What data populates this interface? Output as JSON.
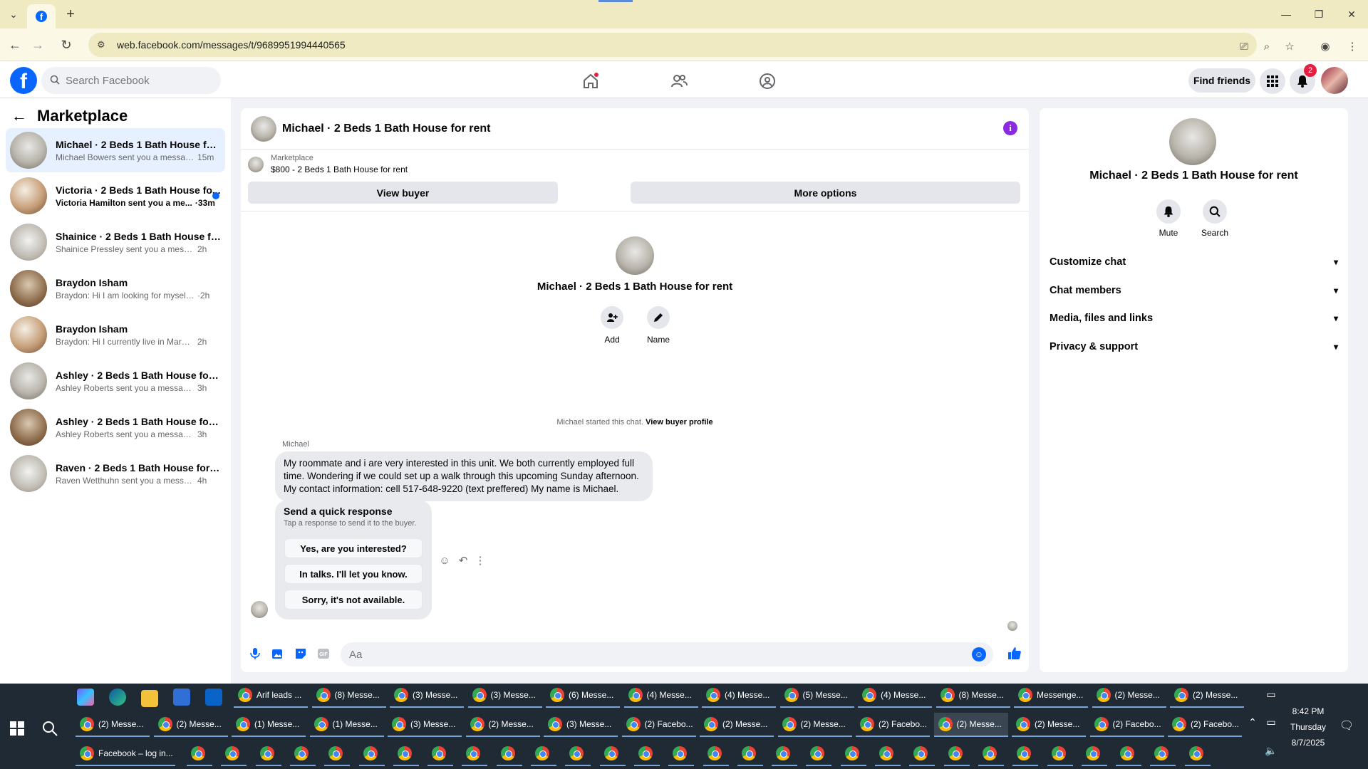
{
  "browser": {
    "url": "web.facebook.com/messages/t/9689951994440565"
  },
  "fb": {
    "search_placeholder": "Search Facebook",
    "find_friends": "Find friends",
    "notif_count": "2"
  },
  "sidebar": {
    "title": "Marketplace",
    "conversations": [
      {
        "name": "Michael · 2 Beds 1 Bath House for ...",
        "snippet": "Michael Bowers sent you a message...",
        "time": "15m",
        "active": true,
        "unread": false
      },
      {
        "name": "Victoria · 2 Beds 1 Bath House fo...",
        "snippet": "Victoria Hamilton sent you a me...",
        "time": "·33m",
        "active": false,
        "unread": true
      },
      {
        "name": "Shainice · 2 Beds 1 Bath House for ...",
        "snippet": "Shainice Pressley sent you a message ...",
        "time": "2h",
        "active": false,
        "unread": false
      },
      {
        "name": "Braydon Isham",
        "snippet": "Braydon: Hi I am looking for myself o...",
        "time": "·2h",
        "active": false,
        "unread": false
      },
      {
        "name": "Braydon Isham",
        "snippet": "Braydon: Hi I currently live in Marquet...",
        "time": "2h",
        "active": false,
        "unread": false
      },
      {
        "name": "Ashley · 2 Beds 1 Bath House for re...",
        "snippet": "Ashley Roberts sent you a message a...",
        "time": "3h",
        "active": false,
        "unread": false
      },
      {
        "name": "Ashley · 2 Beds 1 Bath House for re...",
        "snippet": "Ashley Roberts sent you a message a...",
        "time": "3h",
        "active": false,
        "unread": false
      },
      {
        "name": "Raven · 2 Beds 1 Bath House for rent",
        "snippet": "Raven Wetthuhn sent you a message ...",
        "time": "4h",
        "active": false,
        "unread": false
      }
    ]
  },
  "chat": {
    "title": "Michael · 2 Beds 1 Bath House for rent",
    "listing_source": "Marketplace",
    "listing_title": "$800 - 2 Beds 1 Bath House for rent",
    "view_buyer": "View buyer",
    "more_options": "More options",
    "intro_name": "Michael · 2 Beds 1 Bath House for rent",
    "add_label": "Add",
    "name_label": "Name",
    "started_text": "Michael started this chat.",
    "started_link": "View buyer profile",
    "sender": "Michael",
    "message": "My roommate and i are very interested in this unit. We both currently employed full time. Wondering if we could set up a walk through this upcoming Sunday afternoon. My contact information: cell 517-648-9220 (text preffered) My name is Michael.",
    "quick_title": "Send a quick response",
    "quick_sub": "Tap a response to send it to the buyer.",
    "quick_replies": [
      "Yes, are you interested?",
      "In talks. I'll let you know.",
      "Sorry, it's not available."
    ],
    "input_placeholder": "Aa"
  },
  "info": {
    "name": "Michael · 2 Beds 1 Bath House for rent",
    "mute": "Mute",
    "search": "Search",
    "rows": [
      "Customize chat",
      "Chat members",
      "Media, files and links",
      "Privacy & support"
    ]
  },
  "taskbar": {
    "row1": [
      "Arif leads ...",
      "(8) Messe...",
      "(3) Messe...",
      "(3) Messe...",
      "(6) Messe...",
      "(4) Messe...",
      "(4) Messe...",
      "(5) Messe...",
      "(4) Messe...",
      "(8) Messe...",
      "Messenge...",
      "(2) Messe...",
      "(2) Messe..."
    ],
    "row2": [
      "(2) Messe...",
      "(2) Messe...",
      "(1) Messe...",
      "(1) Messe...",
      "(3) Messe...",
      "(2) Messe...",
      "(3) Messe...",
      "(2) Facebo...",
      "(2) Messe...",
      "(2) Messe...",
      "(2) Facebo...",
      "(2) Messe...",
      "(2) Messe...",
      "(2) Facebo...",
      "(2) Facebo..."
    ],
    "row3_first": "Facebook – log in...",
    "time": "8:42 PM",
    "day": "Thursday",
    "date": "8/7/2025"
  },
  "colors": {
    "fb_blue": "#0866ff",
    "chrome_bar": "#efeac2",
    "taskbar": "#1f2a34"
  }
}
